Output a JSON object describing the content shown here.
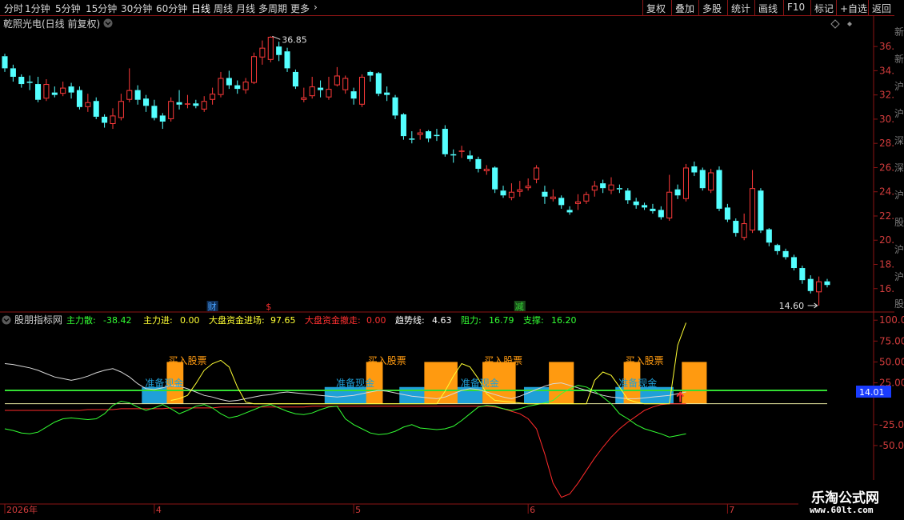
{
  "toolbar": {
    "left_items": [
      "分时",
      "1分钟",
      "5分钟",
      "15分钟",
      "30分钟",
      "60分钟",
      "日线",
      "周线",
      "月线",
      "多周期",
      "更多"
    ],
    "active_index": 6,
    "more_chevron": "chevron-right-icon",
    "right_items": [
      "复权",
      "叠加",
      "多股",
      "统计",
      "画线",
      "F10",
      "标记",
      "+自选",
      "返回"
    ]
  },
  "main_chart": {
    "title": "乾照光电(日线 前复权)",
    "title_chevron": "chevron-down-icon",
    "right_icons": [
      "diamond-outline-icon",
      "diamond-small-icon"
    ],
    "y_ticks": [
      "36.00",
      "34.00",
      "32.00",
      "30.00",
      "28.00",
      "26.00",
      "24.00",
      "22.00",
      "20.00",
      "18.00",
      "16.00"
    ],
    "y_range": [
      14.2,
      37.2
    ],
    "high_label": "36.85",
    "low_label": "14.60",
    "markers": [
      {
        "text": "财",
        "index": 25,
        "color": "#4aa3ff"
      },
      {
        "text": "$",
        "index": 32,
        "color": "#ff3030"
      },
      {
        "text": "减",
        "index": 62,
        "color": "#33cc33"
      }
    ],
    "right_edge_chars": [
      "新",
      "新",
      "沪",
      "沪",
      "深",
      "深",
      "沪",
      "股",
      "沪",
      "沪",
      "股"
    ]
  },
  "chart_data": {
    "type": "candlestick",
    "title": "乾照光电(日线 前复权)",
    "up_color": "#ff3a3a",
    "down_color": "#54ffff",
    "candles": [
      [
        35.2,
        34.2,
        35.4,
        33.9
      ],
      [
        34.2,
        33.5,
        34.5,
        33.1
      ],
      [
        33.5,
        32.9,
        33.7,
        32.6
      ],
      [
        33.1,
        33.0,
        33.6,
        32.4
      ],
      [
        32.9,
        31.6,
        33.5,
        31.4
      ],
      [
        31.7,
        32.9,
        33.3,
        31.5
      ],
      [
        32.2,
        32.0,
        32.7,
        31.8
      ],
      [
        32.1,
        32.6,
        33.1,
        31.9
      ],
      [
        32.7,
        32.2,
        33.0,
        31.7
      ],
      [
        32.4,
        31.0,
        32.7,
        30.8
      ],
      [
        31.0,
        31.4,
        32.1,
        30.6
      ],
      [
        31.5,
        30.2,
        31.8,
        30.0
      ],
      [
        30.2,
        29.7,
        30.4,
        29.3
      ],
      [
        29.6,
        30.3,
        30.9,
        29.2
      ],
      [
        30.1,
        31.5,
        32.1,
        29.9
      ],
      [
        31.6,
        32.4,
        34.2,
        31.4
      ],
      [
        32.4,
        31.6,
        32.8,
        31.2
      ],
      [
        31.7,
        31.1,
        32.0,
        30.6
      ],
      [
        31.1,
        30.1,
        31.6,
        29.9
      ],
      [
        30.3,
        29.8,
        30.5,
        29.2
      ],
      [
        30.0,
        31.5,
        31.8,
        29.8
      ],
      [
        31.4,
        31.2,
        32.4,
        30.8
      ],
      [
        31.2,
        31.3,
        32.0,
        30.9
      ],
      [
        31.3,
        31.1,
        31.6,
        30.9
      ],
      [
        30.8,
        31.5,
        31.9,
        30.6
      ],
      [
        31.6,
        32.1,
        32.6,
        31.2
      ],
      [
        32.0,
        33.4,
        33.9,
        31.8
      ],
      [
        33.4,
        32.8,
        34.0,
        32.5
      ],
      [
        32.8,
        32.5,
        33.2,
        32.1
      ],
      [
        32.4,
        33.1,
        33.4,
        32.1
      ],
      [
        33.0,
        35.2,
        35.5,
        32.9
      ],
      [
        35.1,
        35.9,
        36.5,
        34.5
      ],
      [
        34.9,
        36.8,
        36.85,
        34.7
      ],
      [
        36.0,
        35.3,
        36.4,
        34.8
      ],
      [
        35.6,
        34.2,
        35.9,
        33.9
      ],
      [
        33.9,
        32.7,
        34.1,
        32.5
      ],
      [
        31.6,
        31.8,
        32.6,
        31.4
      ],
      [
        31.9,
        32.7,
        33.5,
        31.7
      ],
      [
        32.6,
        32.4,
        33.2,
        31.8
      ],
      [
        31.8,
        32.5,
        33.5,
        31.6
      ],
      [
        32.8,
        33.6,
        34.3,
        32.7
      ],
      [
        32.4,
        33.4,
        33.6,
        32.1
      ],
      [
        32.3,
        31.7,
        32.6,
        31.2
      ],
      [
        31.2,
        33.5,
        33.7,
        31.0
      ],
      [
        33.9,
        33.6,
        34.0,
        33.1
      ],
      [
        33.8,
        32.1,
        33.9,
        31.9
      ],
      [
        32.2,
        32.0,
        32.7,
        31.5
      ],
      [
        31.8,
        30.3,
        32.0,
        30.0
      ],
      [
        30.4,
        28.6,
        30.5,
        28.3
      ],
      [
        28.4,
        28.3,
        29.0,
        28.0
      ],
      [
        28.7,
        28.9,
        29.2,
        28.3
      ],
      [
        29.0,
        28.4,
        29.1,
        28.1
      ],
      [
        28.7,
        28.6,
        29.2,
        28.2
      ],
      [
        29.2,
        27.1,
        29.5,
        26.9
      ],
      [
        27.1,
        27.0,
        27.5,
        26.4
      ],
      [
        27.3,
        27.4,
        27.8,
        26.8
      ],
      [
        27.0,
        26.7,
        27.4,
        26.5
      ],
      [
        26.7,
        25.9,
        26.9,
        25.6
      ],
      [
        25.7,
        25.9,
        26.2,
        25.4
      ],
      [
        26.0,
        24.2,
        26.1,
        23.9
      ],
      [
        24.1,
        23.7,
        24.5,
        23.5
      ],
      [
        23.5,
        24.0,
        24.7,
        23.3
      ],
      [
        24.0,
        24.2,
        24.9,
        23.6
      ],
      [
        24.3,
        24.5,
        25.1,
        24.1
      ],
      [
        25.0,
        26.0,
        26.2,
        24.7
      ],
      [
        24.0,
        23.6,
        24.5,
        23.0
      ],
      [
        23.4,
        23.6,
        24.2,
        23.2
      ],
      [
        23.5,
        22.9,
        23.7,
        22.6
      ],
      [
        22.5,
        22.3,
        22.8,
        22.1
      ],
      [
        23.0,
        23.2,
        23.8,
        22.5
      ],
      [
        23.2,
        23.8,
        24.0,
        23.0
      ],
      [
        24.1,
        24.5,
        24.9,
        23.6
      ],
      [
        24.7,
        24.3,
        25.0,
        23.9
      ],
      [
        24.1,
        24.6,
        25.2,
        23.8
      ],
      [
        24.3,
        24.2,
        24.6,
        23.9
      ],
      [
        24.1,
        23.3,
        24.3,
        23.0
      ],
      [
        23.2,
        22.9,
        23.5,
        22.6
      ],
      [
        22.9,
        22.7,
        23.1,
        22.5
      ],
      [
        22.6,
        22.4,
        23.0,
        22.2
      ],
      [
        22.5,
        21.9,
        22.8,
        21.7
      ],
      [
        21.8,
        24.0,
        25.4,
        21.6
      ],
      [
        24.2,
        23.7,
        24.6,
        23.4
      ],
      [
        23.4,
        26.0,
        26.3,
        23.2
      ],
      [
        26.1,
        25.6,
        26.5,
        25.3
      ],
      [
        25.8,
        24.3,
        26.0,
        24.1
      ],
      [
        24.1,
        25.6,
        25.9,
        23.9
      ],
      [
        25.8,
        22.6,
        26.1,
        22.4
      ],
      [
        22.7,
        21.7,
        23.0,
        21.5
      ],
      [
        21.6,
        20.6,
        21.8,
        20.3
      ],
      [
        20.2,
        21.4,
        22.2,
        20.0
      ],
      [
        20.8,
        24.3,
        25.8,
        20.6
      ],
      [
        24.1,
        20.8,
        24.3,
        20.6
      ],
      [
        20.9,
        19.8,
        21.0,
        19.5
      ],
      [
        19.6,
        19.1,
        19.7,
        18.8
      ],
      [
        19.1,
        18.6,
        19.3,
        18.4
      ],
      [
        18.6,
        17.7,
        18.8,
        17.5
      ],
      [
        17.7,
        16.7,
        17.9,
        16.4
      ],
      [
        16.8,
        15.8,
        17.1,
        15.6
      ],
      [
        15.7,
        16.6,
        17.0,
        14.6
      ],
      [
        16.6,
        16.3,
        16.8,
        16.1
      ]
    ],
    "indicator": {
      "name": "股朋指标网",
      "legend": [
        {
          "label": "主力散:",
          "value": "-38.42",
          "color": "#33ff33"
        },
        {
          "label": "主力进:",
          "value": "0.00",
          "color": "#ffff33"
        },
        {
          "label": "大盘资金进场:",
          "value": "97.65",
          "color": "#ffff33"
        },
        {
          "label": "大盘资金撤走:",
          "value": "0.00",
          "color": "#ff3030"
        },
        {
          "label": "趋势线:",
          "value": "4.63",
          "color": "#ffffff"
        },
        {
          "label": "阻力:",
          "value": "16.79",
          "color": "#33ff33"
        },
        {
          "label": "支撑:",
          "value": "16.20",
          "color": "#33ff33"
        }
      ],
      "y_ticks": [
        "100.00",
        "75.00",
        "50.00",
        "25.00",
        "-25.00",
        "-50.00"
      ],
      "y_range": [
        -120,
        105
      ],
      "current_value": "14.01",
      "level_line": 16,
      "blue_zones": [
        [
          17,
          21
        ],
        [
          39,
          44
        ],
        [
          48,
          57
        ],
        [
          63,
          67
        ],
        [
          74,
          80
        ]
      ],
      "orange_bars": [
        [
          20,
          21
        ],
        [
          44,
          45
        ],
        [
          51,
          54
        ],
        [
          58,
          61
        ],
        [
          66,
          68
        ],
        [
          75,
          76
        ],
        [
          82,
          84
        ]
      ],
      "labels": [
        {
          "text": "买入股票",
          "index": 20,
          "kind": "buy"
        },
        {
          "text": "准备现金",
          "index": 17,
          "kind": "cash"
        },
        {
          "text": "买入股票",
          "index": 44,
          "kind": "buy"
        },
        {
          "text": "准备现金",
          "index": 40,
          "kind": "cash"
        },
        {
          "text": "买入股票",
          "index": 58,
          "kind": "buy"
        },
        {
          "text": "准备现金",
          "index": 55,
          "kind": "cash"
        },
        {
          "text": "买入股票",
          "index": 75,
          "kind": "buy"
        },
        {
          "text": "准备现金",
          "index": 74,
          "kind": "cash"
        }
      ],
      "arrow_index": 82,
      "green_line": [
        -30,
        -32,
        -35,
        -36,
        -34,
        -28,
        -22,
        -18,
        -17,
        -18,
        -19,
        -18,
        -12,
        -2,
        3,
        1,
        -4,
        -8,
        -5,
        -1,
        -6,
        -12,
        -8,
        -3,
        -1,
        -5,
        -12,
        -17,
        -15,
        -11,
        -7,
        -3,
        -1,
        -5,
        -9,
        -12,
        -13,
        -11,
        -7,
        -4,
        -3,
        -18,
        -25,
        -30,
        -35,
        -37,
        -36,
        -33,
        -28,
        -25,
        -29,
        -30,
        -31,
        -30,
        -27,
        -20,
        -12,
        -4,
        -2,
        -3,
        -6,
        -8,
        -6,
        -3,
        -1,
        1,
        4,
        12,
        18,
        22,
        20,
        15,
        8,
        0,
        -12,
        -18,
        -25,
        -30,
        -33,
        -36,
        -40,
        -38,
        -36
      ],
      "yellow_line": [
        null,
        null,
        null,
        null,
        null,
        null,
        null,
        null,
        null,
        null,
        null,
        null,
        null,
        null,
        null,
        null,
        null,
        null,
        null,
        null,
        4,
        6,
        10,
        24,
        40,
        48,
        52,
        44,
        20,
        2,
        0,
        0,
        0,
        0,
        0,
        0,
        0,
        0,
        0,
        0,
        0,
        0,
        0,
        0,
        0,
        0,
        0,
        0,
        0,
        0,
        0,
        0,
        0,
        15,
        33,
        48,
        44,
        30,
        12,
        4,
        3,
        2,
        1,
        0,
        0,
        0,
        0,
        0,
        0,
        0,
        0,
        28,
        38,
        34,
        20,
        5,
        2,
        0,
        0,
        0,
        0,
        70,
        97
      ],
      "white_line": [
        48,
        47,
        45,
        43,
        40,
        36,
        32,
        30,
        28,
        30,
        33,
        37,
        40,
        42,
        38,
        32,
        24,
        18,
        17,
        19,
        22,
        21,
        18,
        14,
        10,
        8,
        5,
        3,
        4,
        6,
        8,
        10,
        11,
        13,
        14,
        13,
        12,
        11,
        10,
        9,
        8,
        9,
        10,
        12,
        14,
        16,
        15,
        13,
        11,
        9,
        8,
        7,
        6,
        8,
        12,
        16,
        18,
        17,
        14,
        11,
        8,
        6,
        9,
        13,
        17,
        21,
        24,
        25,
        22,
        19,
        16,
        13,
        10,
        8,
        7,
        6,
        6,
        7,
        8,
        9,
        10,
        12,
        14
      ],
      "red_line": [
        -8,
        -8,
        -8,
        -8,
        -8,
        -8,
        -8,
        -8,
        -8,
        -8,
        -7,
        -7,
        -7,
        -7,
        -6,
        -6,
        -6,
        -6,
        -6,
        -6,
        -5,
        -5,
        -5,
        -5,
        -5,
        -5,
        -4,
        -4,
        -4,
        -4,
        -4,
        -4,
        -4,
        -4,
        -4,
        -4,
        -4,
        -3,
        -3,
        -3,
        -3,
        -3,
        -3,
        -3,
        -3,
        -3,
        -3,
        -3,
        -3,
        -3,
        -3,
        -3,
        -3,
        -3,
        -3,
        -3,
        -3,
        -3,
        -3,
        -4,
        -6,
        -9,
        -12,
        -18,
        -30,
        -60,
        -95,
        -112,
        -108,
        -95,
        -80,
        -65,
        -52,
        -40,
        -30,
        -22,
        -15,
        -8,
        -4,
        -1,
        0,
        0,
        0
      ]
    }
  },
  "time_axis": {
    "labels": [
      {
        "text": "2026年",
        "index": 0
      },
      {
        "text": "4",
        "index": 18
      },
      {
        "text": "5",
        "index": 42
      },
      {
        "text": "6",
        "index": 63
      },
      {
        "text": "7",
        "index": 87
      }
    ]
  },
  "watermark": {
    "line1": "乐淘公式网",
    "line2": "www.60lt.com"
  }
}
